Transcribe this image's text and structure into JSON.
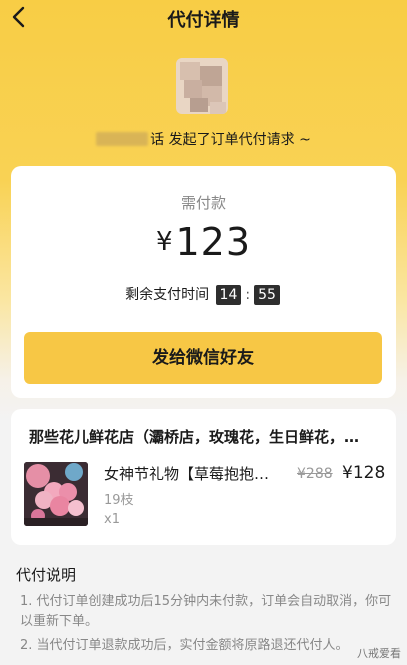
{
  "header": {
    "title": "代付详情"
  },
  "request": {
    "message": "发起了订单代付请求 ~",
    "name_visible_suffix": "话"
  },
  "payment": {
    "label": "需付款",
    "currency": "¥",
    "amount": "123",
    "countdown_label": "剩余支付时间",
    "minutes": "14",
    "seconds": "55",
    "separator": ":",
    "share_button": "发给微信好友"
  },
  "order": {
    "shop_name": "那些花儿鲜花店（灞桥店，玫瑰花，生日鲜花，…",
    "product": {
      "title": "女神节礼物【草莓抱抱…",
      "variant": "19枝",
      "quantity": "x1",
      "original_price": "¥288",
      "price": "¥128"
    }
  },
  "instructions": {
    "title": "代付说明",
    "items": [
      "1. 代付订单创建成功后15分钟内未付款，订单会自动取消，你可以重新下单。",
      "2. 当代付订单退款成功后，实付金额将原路退还代付人。"
    ]
  },
  "watermark": "八戒爱看",
  "colors": {
    "accent": "#F7C745",
    "header_bg": "#F8CD45",
    "text": "#1A1A1A",
    "muted": "#888888"
  }
}
